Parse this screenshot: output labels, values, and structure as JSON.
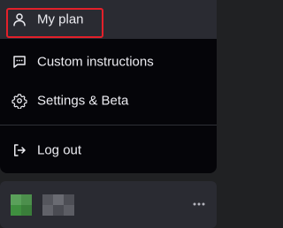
{
  "menu": {
    "items": [
      {
        "label": "My plan",
        "icon": "user-icon"
      },
      {
        "label": "Custom instructions",
        "icon": "chat-bubble-icon"
      },
      {
        "label": "Settings & Beta",
        "icon": "gear-icon"
      },
      {
        "label": "Log out",
        "icon": "log-out-icon"
      }
    ]
  },
  "colors": {
    "menu_background": "#050509",
    "hover_background": "#2a2b32",
    "text": "#ececf1",
    "highlight_outline": "#e3202a",
    "avatar_green": "#3f8f3f"
  }
}
